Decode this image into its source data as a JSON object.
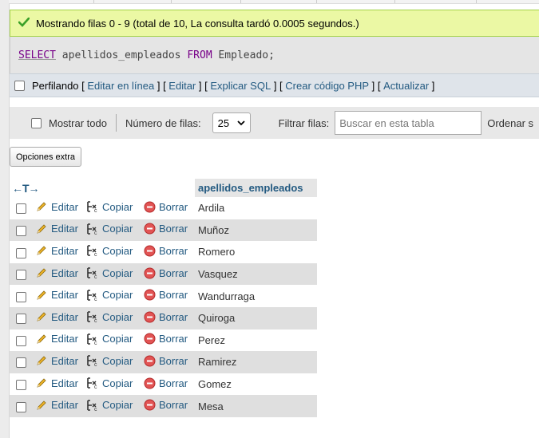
{
  "success_message": "Mostrando filas 0 - 9 (total de 10, La consulta tardó 0.0005 segundos.)",
  "sql": {
    "kw_select": "SELECT",
    "col": " apellidos_empleados ",
    "kw_from": "FROM",
    "table": " Empleado;"
  },
  "profiling": {
    "label": "Perfilando",
    "links": [
      "Editar en línea",
      "Editar",
      "Explicar SQL",
      "Crear código PHP",
      "Actualizar"
    ]
  },
  "nav": {
    "show_all": "Mostrar todo",
    "rows_label": "Número de filas:",
    "rows_value": "25",
    "filter_label": "Filtrar filas:",
    "filter_placeholder": "Buscar en esta tabla",
    "sort_label": "Ordenar s"
  },
  "extra_options": "Opciones extra",
  "table": {
    "arrows": "←T→",
    "column": "apellidos_empleados",
    "action_edit": "Editar",
    "action_copy": "Copiar",
    "action_delete": "Borrar",
    "rows": [
      "Ardila",
      "Muñoz",
      "Romero",
      "Vasquez",
      "Wandurraga",
      "Quiroga",
      "Perez",
      "Ramirez",
      "Gomez",
      "Mesa"
    ]
  },
  "colors": {
    "link": "#235a81",
    "success_bg": "#ebf8a4",
    "success_border": "#a2d246",
    "sql_keyword": "#770088"
  }
}
